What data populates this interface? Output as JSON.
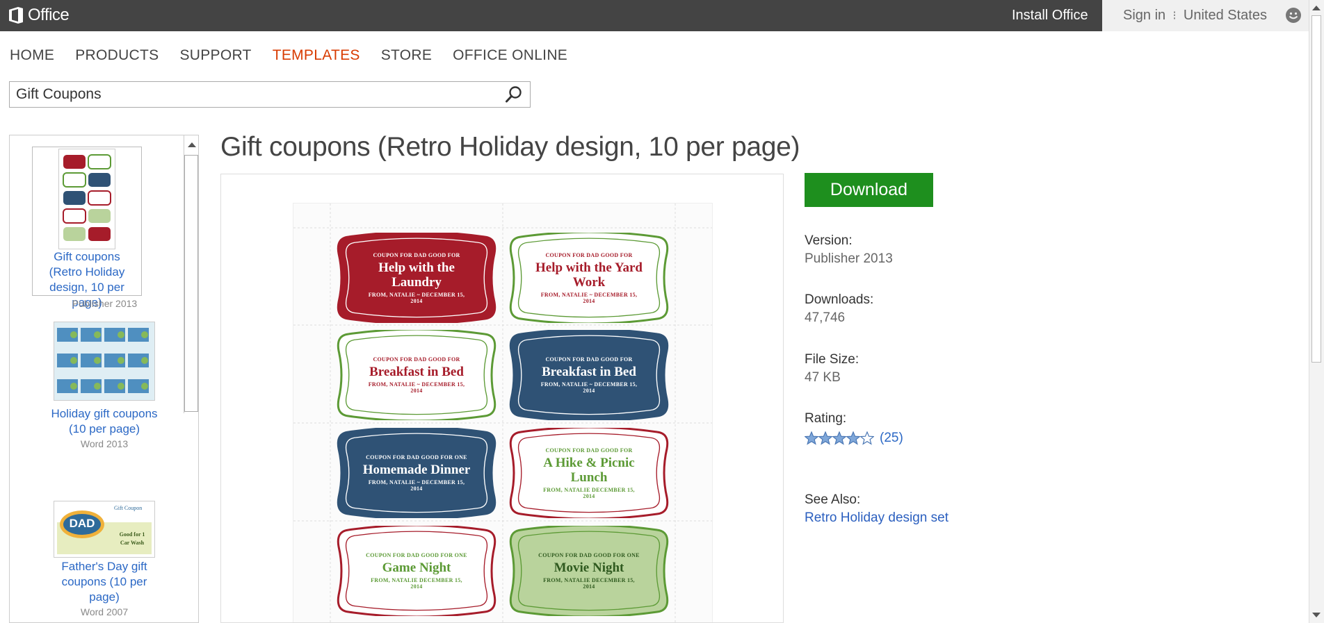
{
  "header": {
    "logo_text": "Office",
    "install_label": "Install Office",
    "signin_label": "Sign in",
    "separator": "⁝",
    "region_label": "United States"
  },
  "nav": {
    "items": [
      "HOME",
      "PRODUCTS",
      "SUPPORT",
      "TEMPLATES",
      "STORE",
      "OFFICE ONLINE"
    ],
    "active": "TEMPLATES"
  },
  "search": {
    "value": "Gift Coupons"
  },
  "sidebar": {
    "items": [
      {
        "title": "Gift coupons (Retro Holiday design, 10 per page)",
        "app": "Publisher 2013"
      },
      {
        "title": "Holiday gift coupons (10 per page)",
        "app": "Word 2013"
      },
      {
        "title": "Father's Day gift coupons (10 per page)",
        "app": "Word 2007",
        "thumb_title": "Gift Coupon",
        "thumb_badge": "DAD",
        "thumb_text": "Good for 1 Car Wash"
      }
    ]
  },
  "main": {
    "title": "Gift coupons (Retro Holiday design, 10 per page)",
    "coupons": [
      {
        "top": "COUPON FOR DAD GOOD FOR",
        "title": "Help with the Laundry",
        "from": "FROM, NATALIE ~ DECEMBER 15, 2014",
        "style": "red"
      },
      {
        "top": "COUPON FOR DAD GOOD FOR",
        "title": "Help with the Yard Work",
        "from": "FROM, NATALIE ~ DECEMBER 15, 2014",
        "style": "white-green"
      },
      {
        "top": "COUPON FOR DAD GOOD FOR",
        "title": "Breakfast in Bed",
        "from": "FROM, NATALIE ~ DECEMBER 15, 2014",
        "style": "white-green"
      },
      {
        "top": "COUPON FOR DAD GOOD FOR",
        "title": "Breakfast in Bed",
        "from": "FROM, NATALIE ~ DECEMBER 15, 2014",
        "style": "blue"
      },
      {
        "top": "COUPON FOR DAD GOOD FOR ONE",
        "title": "Homemade Dinner",
        "from": "FROM, NATALIE ~ DECEMBER 15, 2014",
        "style": "blue"
      },
      {
        "top": "COUPON FOR DAD GOOD FOR",
        "title": "A Hike & Picnic Lunch",
        "from": "FROM, NATALIE DECEMBER 15, 2014",
        "style": "white-red"
      },
      {
        "top": "COUPON FOR DAD GOOD FOR ONE",
        "title": "Game Night",
        "from": "FROM, NATALIE DECEMBER 15, 2014",
        "style": "white-red"
      },
      {
        "top": "COUPON FOR DAD GOOD FOR ONE",
        "title": "Movie Night",
        "from": "FROM, NATALIE DECEMBER 15, 2014",
        "style": "sage"
      }
    ]
  },
  "details": {
    "download_label": "Download",
    "version_label": "Version:",
    "version_value": "Publisher 2013",
    "downloads_label": "Downloads:",
    "downloads_value": "47,746",
    "filesize_label": "File Size:",
    "filesize_value": "47 KB",
    "rating_label": "Rating:",
    "rating_value": 4,
    "rating_max": 5,
    "rating_count": "(25)",
    "seealso_label": "See Also:",
    "seealso_link": "Retro Holiday design set"
  },
  "colors": {
    "accent_nav": "#d83b01",
    "download_green": "#1e8f1e",
    "link_blue": "#2b68c5",
    "coupon_red": "#a61c2a",
    "coupon_green": "#5c9a35",
    "coupon_blue": "#2f5275",
    "coupon_sage": "#b9d39c"
  }
}
